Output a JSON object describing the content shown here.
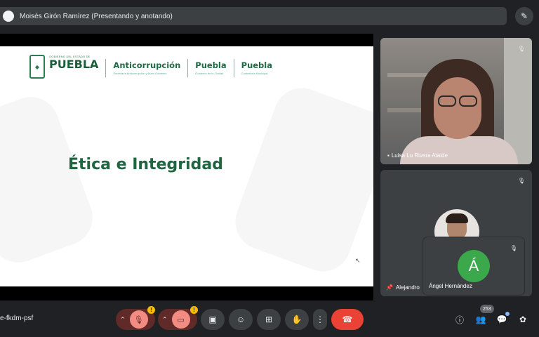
{
  "presenter_bar": {
    "label": "Moisés Girón Ramírez (Presentando y anotando)"
  },
  "slide": {
    "gov_small": "GOBIERNO DEL ESTADO DE",
    "gov_big": "PUEBLA",
    "orgs": [
      {
        "title": "Anticorrupción",
        "subtitle": "Secretaría Anticorrupción y Buen Gobierno"
      },
      {
        "title": "Puebla",
        "subtitle": "Gobierno de la Ciudad"
      },
      {
        "title": "Puebla",
        "subtitle": "Contraloría Municipal"
      }
    ],
    "title": "Ética e Integridad"
  },
  "tiles": {
    "speaker_name": "Luisa Lu Rivera Ataide",
    "second_name": "Alejandro",
    "third_initial": "Á",
    "third_name": "Ángel Hernández"
  },
  "meeting_code": "e-fkdm-psf",
  "participants_count": "253",
  "warning_badge": "!",
  "icons": {
    "draw": "pencil-annotate-icon",
    "mic": "mic-off-icon",
    "camera": "camera-off-icon",
    "captions": "captions-icon",
    "emoji": "emoji-icon",
    "present": "present-screen-icon",
    "raise_hand": "raise-hand-icon",
    "more": "more-options-icon",
    "end_call": "end-call-icon",
    "info": "info-icon",
    "people": "people-icon",
    "chat": "chat-icon",
    "activities": "activities-icon"
  },
  "colors": {
    "end_call": "#ea4335",
    "muted": "#f28b82",
    "avatar_green": "#3aa84b",
    "brand_green": "#1e6540"
  }
}
